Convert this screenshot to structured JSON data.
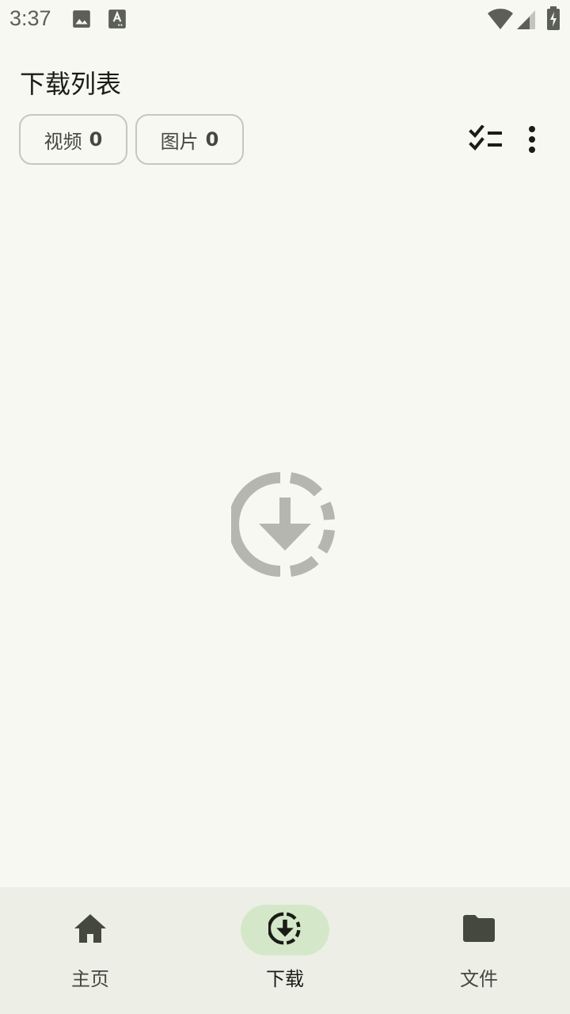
{
  "status_bar": {
    "time": "3:37",
    "left_icons": [
      "image-icon",
      "text-notification-icon"
    ],
    "right_icons": [
      "wifi-icon",
      "cell-signal-icon",
      "battery-charging-icon"
    ]
  },
  "header": {
    "title": "下载列表"
  },
  "filters": [
    {
      "label": "视频",
      "count": "0"
    },
    {
      "label": "图片",
      "count": "0"
    }
  ],
  "toolbar": {
    "icons": [
      "checklist-icon",
      "more-vert-icon"
    ]
  },
  "empty_state": {
    "icon": "download-circle-icon"
  },
  "bottom_nav": {
    "items": [
      {
        "label": "主页",
        "icon": "home-icon",
        "active": false
      },
      {
        "label": "下载",
        "icon": "download-icon",
        "active": true
      },
      {
        "label": "文件",
        "icon": "folder-icon",
        "active": false
      }
    ]
  },
  "colors": {
    "background": "#f7f8f1",
    "nav_background": "#edefe7",
    "active_indicator": "#d4e8c9",
    "chip_border": "#c5c8bf",
    "empty_icon": "#b5b6b0"
  }
}
